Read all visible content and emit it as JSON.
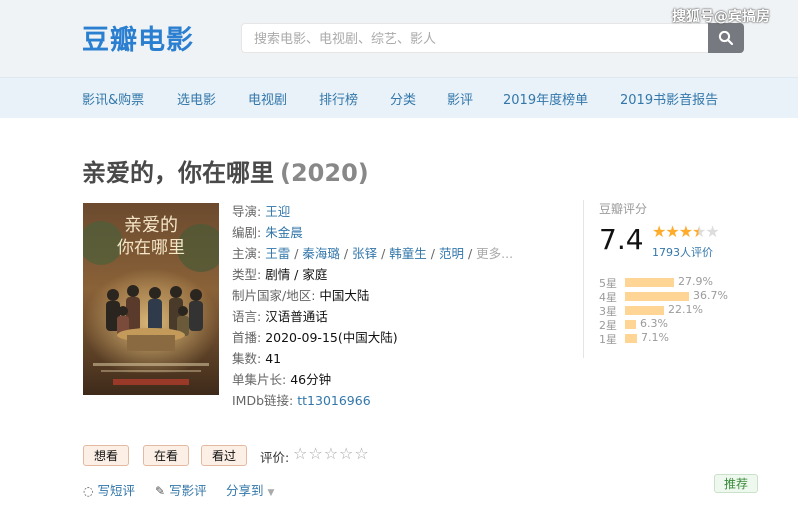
{
  "header": {
    "logo": "豆瓣电影",
    "search_placeholder": "搜索电影、电视剧、综艺、影人",
    "watermark": "搜狐号@宾搞房",
    "search_icon": "search-icon"
  },
  "nav": [
    "影讯&购票",
    "选电影",
    "电视剧",
    "排行榜",
    "分类",
    "影评",
    "2019年度榜单",
    "2019书影音报告"
  ],
  "title": "亲爱的，你在哪里",
  "year": "(2020)",
  "poster": {
    "title_text_1": "亲爱的",
    "title_text_2": "你在哪里"
  },
  "info": {
    "director_label": "导演:",
    "director": "王迎",
    "writer_label": "编剧:",
    "writer": "朱金晨",
    "cast_label": "主演:",
    "cast": [
      "王雷",
      "秦海璐",
      "张铎",
      "韩童生",
      "范明"
    ],
    "cast_sep": " / ",
    "cast_more": "更多...",
    "genre_label": "类型:",
    "genre": "剧情 / 家庭",
    "country_label": "制片国家/地区:",
    "country": "中国大陆",
    "language_label": "语言:",
    "language": "汉语普通话",
    "premiere_label": "首播:",
    "premiere": "2020-09-15(中国大陆)",
    "episodes_label": "集数:",
    "episodes": "41",
    "runtime_label": "单集片长:",
    "runtime": "46分钟",
    "imdb_label": "IMDb链接:",
    "imdb": "tt13016966"
  },
  "rating": {
    "title": "豆瓣评分",
    "score": "7.4",
    "stars_filled": 3.5,
    "count": "1793人评价",
    "rows": [
      {
        "label": "5星",
        "pct": "27.9%",
        "value": 27.9
      },
      {
        "label": "4星",
        "pct": "36.7%",
        "value": 36.7
      },
      {
        "label": "3星",
        "pct": "22.1%",
        "value": 22.1
      },
      {
        "label": "2星",
        "pct": "6.3%",
        "value": 6.3
      },
      {
        "label": "1星",
        "pct": "7.1%",
        "value": 7.1
      }
    ]
  },
  "actions": {
    "want": "想看",
    "watching": "在看",
    "watched": "看过",
    "rate_label": "评价:",
    "write_short": "写短评",
    "write_review": "写影评",
    "share": "分享到",
    "recommend": "推荐"
  }
}
